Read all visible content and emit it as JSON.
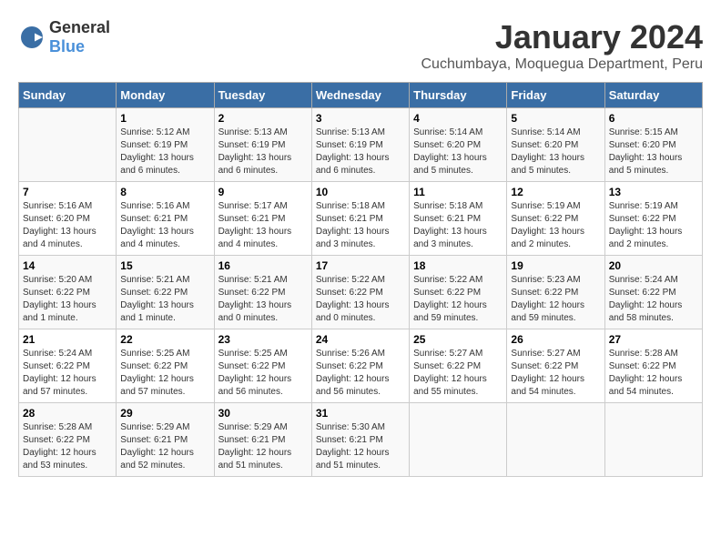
{
  "header": {
    "logo_general": "General",
    "logo_blue": "Blue",
    "month_title": "January 2024",
    "location": "Cuchumbaya, Moquegua Department, Peru"
  },
  "days_of_week": [
    "Sunday",
    "Monday",
    "Tuesday",
    "Wednesday",
    "Thursday",
    "Friday",
    "Saturday"
  ],
  "weeks": [
    [
      {
        "day": "",
        "sunrise": "",
        "sunset": "",
        "daylight": ""
      },
      {
        "day": "1",
        "sunrise": "Sunrise: 5:12 AM",
        "sunset": "Sunset: 6:19 PM",
        "daylight": "Daylight: 13 hours and 6 minutes."
      },
      {
        "day": "2",
        "sunrise": "Sunrise: 5:13 AM",
        "sunset": "Sunset: 6:19 PM",
        "daylight": "Daylight: 13 hours and 6 minutes."
      },
      {
        "day": "3",
        "sunrise": "Sunrise: 5:13 AM",
        "sunset": "Sunset: 6:19 PM",
        "daylight": "Daylight: 13 hours and 6 minutes."
      },
      {
        "day": "4",
        "sunrise": "Sunrise: 5:14 AM",
        "sunset": "Sunset: 6:20 PM",
        "daylight": "Daylight: 13 hours and 5 minutes."
      },
      {
        "day": "5",
        "sunrise": "Sunrise: 5:14 AM",
        "sunset": "Sunset: 6:20 PM",
        "daylight": "Daylight: 13 hours and 5 minutes."
      },
      {
        "day": "6",
        "sunrise": "Sunrise: 5:15 AM",
        "sunset": "Sunset: 6:20 PM",
        "daylight": "Daylight: 13 hours and 5 minutes."
      }
    ],
    [
      {
        "day": "7",
        "sunrise": "Sunrise: 5:16 AM",
        "sunset": "Sunset: 6:20 PM",
        "daylight": "Daylight: 13 hours and 4 minutes."
      },
      {
        "day": "8",
        "sunrise": "Sunrise: 5:16 AM",
        "sunset": "Sunset: 6:21 PM",
        "daylight": "Daylight: 13 hours and 4 minutes."
      },
      {
        "day": "9",
        "sunrise": "Sunrise: 5:17 AM",
        "sunset": "Sunset: 6:21 PM",
        "daylight": "Daylight: 13 hours and 4 minutes."
      },
      {
        "day": "10",
        "sunrise": "Sunrise: 5:18 AM",
        "sunset": "Sunset: 6:21 PM",
        "daylight": "Daylight: 13 hours and 3 minutes."
      },
      {
        "day": "11",
        "sunrise": "Sunrise: 5:18 AM",
        "sunset": "Sunset: 6:21 PM",
        "daylight": "Daylight: 13 hours and 3 minutes."
      },
      {
        "day": "12",
        "sunrise": "Sunrise: 5:19 AM",
        "sunset": "Sunset: 6:22 PM",
        "daylight": "Daylight: 13 hours and 2 minutes."
      },
      {
        "day": "13",
        "sunrise": "Sunrise: 5:19 AM",
        "sunset": "Sunset: 6:22 PM",
        "daylight": "Daylight: 13 hours and 2 minutes."
      }
    ],
    [
      {
        "day": "14",
        "sunrise": "Sunrise: 5:20 AM",
        "sunset": "Sunset: 6:22 PM",
        "daylight": "Daylight: 13 hours and 1 minute."
      },
      {
        "day": "15",
        "sunrise": "Sunrise: 5:21 AM",
        "sunset": "Sunset: 6:22 PM",
        "daylight": "Daylight: 13 hours and 1 minute."
      },
      {
        "day": "16",
        "sunrise": "Sunrise: 5:21 AM",
        "sunset": "Sunset: 6:22 PM",
        "daylight": "Daylight: 13 hours and 0 minutes."
      },
      {
        "day": "17",
        "sunrise": "Sunrise: 5:22 AM",
        "sunset": "Sunset: 6:22 PM",
        "daylight": "Daylight: 13 hours and 0 minutes."
      },
      {
        "day": "18",
        "sunrise": "Sunrise: 5:22 AM",
        "sunset": "Sunset: 6:22 PM",
        "daylight": "Daylight: 12 hours and 59 minutes."
      },
      {
        "day": "19",
        "sunrise": "Sunrise: 5:23 AM",
        "sunset": "Sunset: 6:22 PM",
        "daylight": "Daylight: 12 hours and 59 minutes."
      },
      {
        "day": "20",
        "sunrise": "Sunrise: 5:24 AM",
        "sunset": "Sunset: 6:22 PM",
        "daylight": "Daylight: 12 hours and 58 minutes."
      }
    ],
    [
      {
        "day": "21",
        "sunrise": "Sunrise: 5:24 AM",
        "sunset": "Sunset: 6:22 PM",
        "daylight": "Daylight: 12 hours and 57 minutes."
      },
      {
        "day": "22",
        "sunrise": "Sunrise: 5:25 AM",
        "sunset": "Sunset: 6:22 PM",
        "daylight": "Daylight: 12 hours and 57 minutes."
      },
      {
        "day": "23",
        "sunrise": "Sunrise: 5:25 AM",
        "sunset": "Sunset: 6:22 PM",
        "daylight": "Daylight: 12 hours and 56 minutes."
      },
      {
        "day": "24",
        "sunrise": "Sunrise: 5:26 AM",
        "sunset": "Sunset: 6:22 PM",
        "daylight": "Daylight: 12 hours and 56 minutes."
      },
      {
        "day": "25",
        "sunrise": "Sunrise: 5:27 AM",
        "sunset": "Sunset: 6:22 PM",
        "daylight": "Daylight: 12 hours and 55 minutes."
      },
      {
        "day": "26",
        "sunrise": "Sunrise: 5:27 AM",
        "sunset": "Sunset: 6:22 PM",
        "daylight": "Daylight: 12 hours and 54 minutes."
      },
      {
        "day": "27",
        "sunrise": "Sunrise: 5:28 AM",
        "sunset": "Sunset: 6:22 PM",
        "daylight": "Daylight: 12 hours and 54 minutes."
      }
    ],
    [
      {
        "day": "28",
        "sunrise": "Sunrise: 5:28 AM",
        "sunset": "Sunset: 6:22 PM",
        "daylight": "Daylight: 12 hours and 53 minutes."
      },
      {
        "day": "29",
        "sunrise": "Sunrise: 5:29 AM",
        "sunset": "Sunset: 6:21 PM",
        "daylight": "Daylight: 12 hours and 52 minutes."
      },
      {
        "day": "30",
        "sunrise": "Sunrise: 5:29 AM",
        "sunset": "Sunset: 6:21 PM",
        "daylight": "Daylight: 12 hours and 51 minutes."
      },
      {
        "day": "31",
        "sunrise": "Sunrise: 5:30 AM",
        "sunset": "Sunset: 6:21 PM",
        "daylight": "Daylight: 12 hours and 51 minutes."
      },
      {
        "day": "",
        "sunrise": "",
        "sunset": "",
        "daylight": ""
      },
      {
        "day": "",
        "sunrise": "",
        "sunset": "",
        "daylight": ""
      },
      {
        "day": "",
        "sunrise": "",
        "sunset": "",
        "daylight": ""
      }
    ]
  ]
}
